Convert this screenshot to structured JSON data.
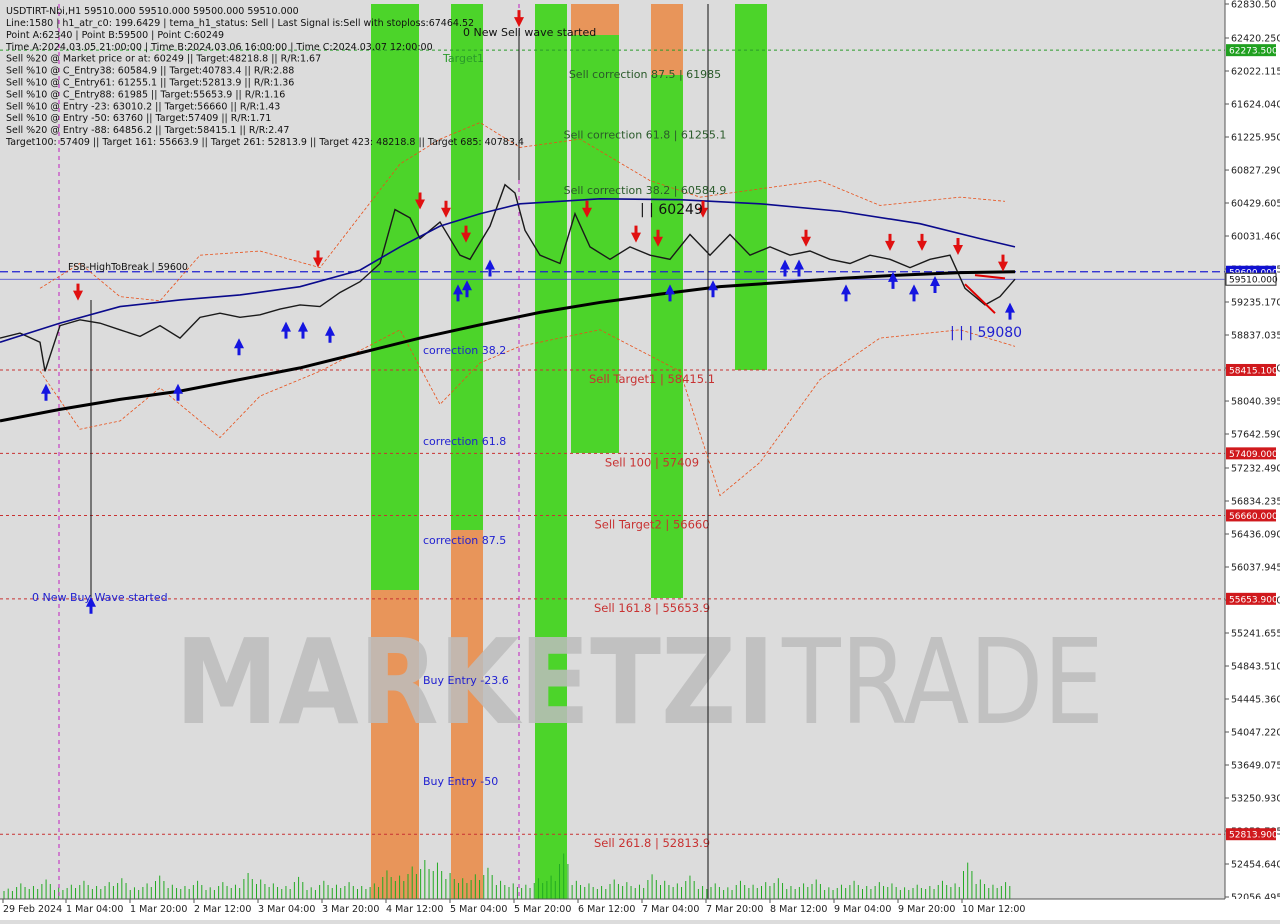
{
  "header": {
    "symbol_line": "USDTIRT-Nbi,H1  59510.000 59510.000 59500.000 59510.000",
    "info_lines": [
      "Line:1580 | h1_atr_c0: 199.6429 | tema_h1_status: Sell | Last Signal is:Sell with stoploss:67464.52",
      "Point A:62340 | Point B:59500 | Point C:60249",
      "Time A:2024.03.05 21:00:00 | Time B:2024.03.06 16:00:00 | Time C:2024.03.07 12:00:00",
      "Sell %20 @ Market price or at: 60249 || Target:48218.8 || R/R:1.67",
      "Sell %10 @ C_Entry38: 60584.9 || Target:40783.4 || R/R:2.88",
      "Sell %10 @ C_Entry61: 61255.1 || Target:52813.9 || R/R:1.36",
      "Sell %10 @ C_Entry88: 61985 || Target:55653.9 || R/R:1.16",
      "Sell %10 @ Entry -23: 63010.2 || Target:56660 || R/R:1.43",
      "Sell %10 @ Entry -50: 63760 || Target:57409 || R/R:1.71",
      "Sell %20 @ Entry -88: 64856.2 || Target:58415.1 || R/R:2.47",
      "Target100: 57409 || Target 161: 55663.9 || Target 261: 52813.9 || Target 423: 48218.8 || Target 685: 40783.4"
    ]
  },
  "watermark": {
    "bold": "MARKETZI",
    "light": "TRADE"
  },
  "colors": {
    "background": "#dcdcdc",
    "green_zone": "#4cd42a",
    "orange_zone": "#e8955a",
    "red_level": "#c83232",
    "blue": "#1f1fd0",
    "ma_dark": "#000000",
    "ma_navy": "#0a0a8c",
    "envelope": "#e8501a",
    "price_tag_red": "#d0191d",
    "price_tag_blue": "#1010d0",
    "price_tag_green": "#20a020"
  },
  "chart_data": {
    "type": "line",
    "title": "USDTIRT-Nbi,H1",
    "ylim": [
      52056.495,
      62830.5
    ],
    "y_ticks": [
      "62830.50",
      "62420.250",
      "62022.115",
      "61624.040",
      "61225.950",
      "60827.290",
      "60429.605",
      "60031.460",
      "59633.385",
      "59235.170",
      "58837.035",
      "58438.290",
      "58040.395",
      "57642.590",
      "57232.490",
      "56834.235",
      "56436.090",
      "56037.945",
      "55639.000",
      "55241.655",
      "54843.510",
      "54445.360",
      "54047.220",
      "53649.075",
      "53250.930",
      "52852.785",
      "52454.640",
      "52056.495"
    ],
    "y_tick_values": [
      62830.5,
      62420.25,
      62022.115,
      61624.04,
      61225.95,
      60827.29,
      60429.605,
      60031.46,
      59633.385,
      59235.17,
      58837.035,
      58438.29,
      58040.395,
      57642.59,
      57232.49,
      56834.235,
      56436.09,
      56037.945,
      55639.0,
      55241.655,
      54843.51,
      54445.36,
      54047.22,
      53649.075,
      53250.93,
      52852.785,
      52454.64,
      52056.495
    ],
    "x_ticks": [
      "29 Feb 2024",
      "1 Mar 04:00",
      "1 Mar 20:00",
      "2 Mar 12:00",
      "3 Mar 04:00",
      "3 Mar 20:00",
      "4 Mar 12:00",
      "5 Mar 04:00",
      "5 Mar 20:00",
      "6 Mar 12:00",
      "7 Mar 04:00",
      "7 Mar 20:00",
      "8 Mar 12:00",
      "9 Mar 04:00",
      "9 Mar 20:00",
      "10 Mar 12:00"
    ],
    "price_tags": [
      {
        "text": "62273.500",
        "value": 62273.5,
        "kind": "green"
      },
      {
        "text": "59600.000",
        "value": 59600.0,
        "kind": "blue"
      },
      {
        "text": "59510.000",
        "value": 59510.0,
        "kind": "white"
      },
      {
        "text": "58415.100",
        "value": 58415.1,
        "kind": "red"
      },
      {
        "text": "57409.000",
        "value": 57409.0,
        "kind": "red"
      },
      {
        "text": "56660.000",
        "value": 56660.0,
        "kind": "red"
      },
      {
        "text": "55653.900",
        "value": 55653.9,
        "kind": "red"
      },
      {
        "text": "52813.900",
        "value": 52813.9,
        "kind": "red"
      }
    ],
    "levels": [
      {
        "label": "Sell Target1 | 58415.1",
        "value": 58415.1
      },
      {
        "label": "Sell 100 | 57409",
        "value": 57409
      },
      {
        "label": "Sell Target2 | 56660",
        "value": 56660
      },
      {
        "label": "Sell 161.8 | 55653.9",
        "value": 55653.9
      },
      {
        "label": "Sell 261.8 | 52813.9",
        "value": 52813.9
      }
    ],
    "sell_corrections": [
      {
        "label": "Sell correction 87.5 | 61985",
        "value": 61985
      },
      {
        "label": "Sell correction 61.8 | 61255.1",
        "value": 61255.1
      },
      {
        "label": "Sell correction 38.2 | 60584.9",
        "value": 60584.9
      }
    ],
    "buy_labels": [
      "correction 38.2",
      "correction 61.8",
      "correction 87.5",
      "Buy Entry -23.6",
      "Buy Entry -50"
    ],
    "texts": {
      "sell_wave": "0 New Sell wave started",
      "buy_wave": "0 New Buy Wave started",
      "fsb": "FSB-HighToBreak | 59600",
      "target1": "Target1",
      "point_c": "| | 60249",
      "point_current": "| | | 59080"
    },
    "ma200": [
      [
        0,
        57800
      ],
      [
        60,
        57940
      ],
      [
        120,
        58060
      ],
      [
        180,
        58160
      ],
      [
        240,
        58300
      ],
      [
        300,
        58440
      ],
      [
        360,
        58620
      ],
      [
        420,
        58800
      ],
      [
        480,
        58960
      ],
      [
        540,
        59110
      ],
      [
        600,
        59230
      ],
      [
        660,
        59330
      ],
      [
        720,
        59420
      ],
      [
        780,
        59470
      ],
      [
        840,
        59520
      ],
      [
        900,
        59560
      ],
      [
        960,
        59590
      ],
      [
        1015,
        59600
      ]
    ],
    "ma50": [
      [
        0,
        58750
      ],
      [
        60,
        58980
      ],
      [
        120,
        59180
      ],
      [
        180,
        59260
      ],
      [
        240,
        59320
      ],
      [
        300,
        59420
      ],
      [
        360,
        59620
      ],
      [
        400,
        59900
      ],
      [
        440,
        60150
      ],
      [
        480,
        60300
      ],
      [
        520,
        60420
      ],
      [
        600,
        60480
      ],
      [
        680,
        60470
      ],
      [
        760,
        60420
      ],
      [
        840,
        60330
      ],
      [
        920,
        60180
      ],
      [
        980,
        60000
      ],
      [
        1015,
        59900
      ]
    ],
    "close": [
      [
        0,
        58800
      ],
      [
        20,
        58860
      ],
      [
        40,
        58750
      ],
      [
        45,
        58400
      ],
      [
        60,
        58950
      ],
      [
        80,
        59020
      ],
      [
        100,
        58980
      ],
      [
        120,
        58900
      ],
      [
        140,
        58820
      ],
      [
        160,
        58950
      ],
      [
        180,
        58800
      ],
      [
        200,
        59050
      ],
      [
        220,
        59100
      ],
      [
        240,
        59050
      ],
      [
        260,
        59080
      ],
      [
        280,
        59150
      ],
      [
        300,
        59200
      ],
      [
        320,
        59180
      ],
      [
        340,
        59350
      ],
      [
        360,
        59480
      ],
      [
        380,
        59700
      ],
      [
        395,
        60350
      ],
      [
        410,
        60250
      ],
      [
        420,
        60000
      ],
      [
        440,
        60200
      ],
      [
        460,
        59800
      ],
      [
        470,
        59750
      ],
      [
        490,
        60150
      ],
      [
        505,
        60650
      ],
      [
        515,
        60550
      ],
      [
        525,
        60100
      ],
      [
        540,
        59800
      ],
      [
        560,
        59700
      ],
      [
        575,
        60300
      ],
      [
        590,
        59900
      ],
      [
        610,
        59750
      ],
      [
        630,
        59900
      ],
      [
        650,
        59800
      ],
      [
        670,
        59750
      ],
      [
        690,
        60050
      ],
      [
        710,
        59800
      ],
      [
        730,
        60050
      ],
      [
        750,
        59800
      ],
      [
        770,
        59900
      ],
      [
        790,
        59800
      ],
      [
        810,
        59850
      ],
      [
        830,
        59750
      ],
      [
        850,
        59700
      ],
      [
        870,
        59800
      ],
      [
        890,
        59750
      ],
      [
        910,
        59650
      ],
      [
        930,
        59750
      ],
      [
        950,
        59800
      ],
      [
        965,
        59400
      ],
      [
        985,
        59200
      ],
      [
        1000,
        59300
      ],
      [
        1015,
        59510
      ]
    ],
    "volume": [
      8,
      12,
      10,
      15,
      9,
      11,
      14,
      10,
      13,
      16,
      9,
      12,
      18,
      11,
      10,
      14,
      9,
      13,
      11,
      20,
      15,
      12,
      10,
      17,
      9,
      14,
      11,
      13,
      10,
      12,
      22,
      18,
      25,
      30,
      28,
      20,
      16,
      19,
      24,
      14,
      12,
      11,
      16,
      18,
      35,
      14,
      12,
      10,
      15,
      13,
      11,
      19,
      14,
      12,
      18,
      10,
      12,
      9,
      14,
      11,
      13,
      16,
      10,
      12,
      15,
      9,
      11,
      14,
      10,
      13,
      12,
      9,
      11,
      10,
      14,
      12,
      28,
      15,
      11,
      13
    ]
  }
}
